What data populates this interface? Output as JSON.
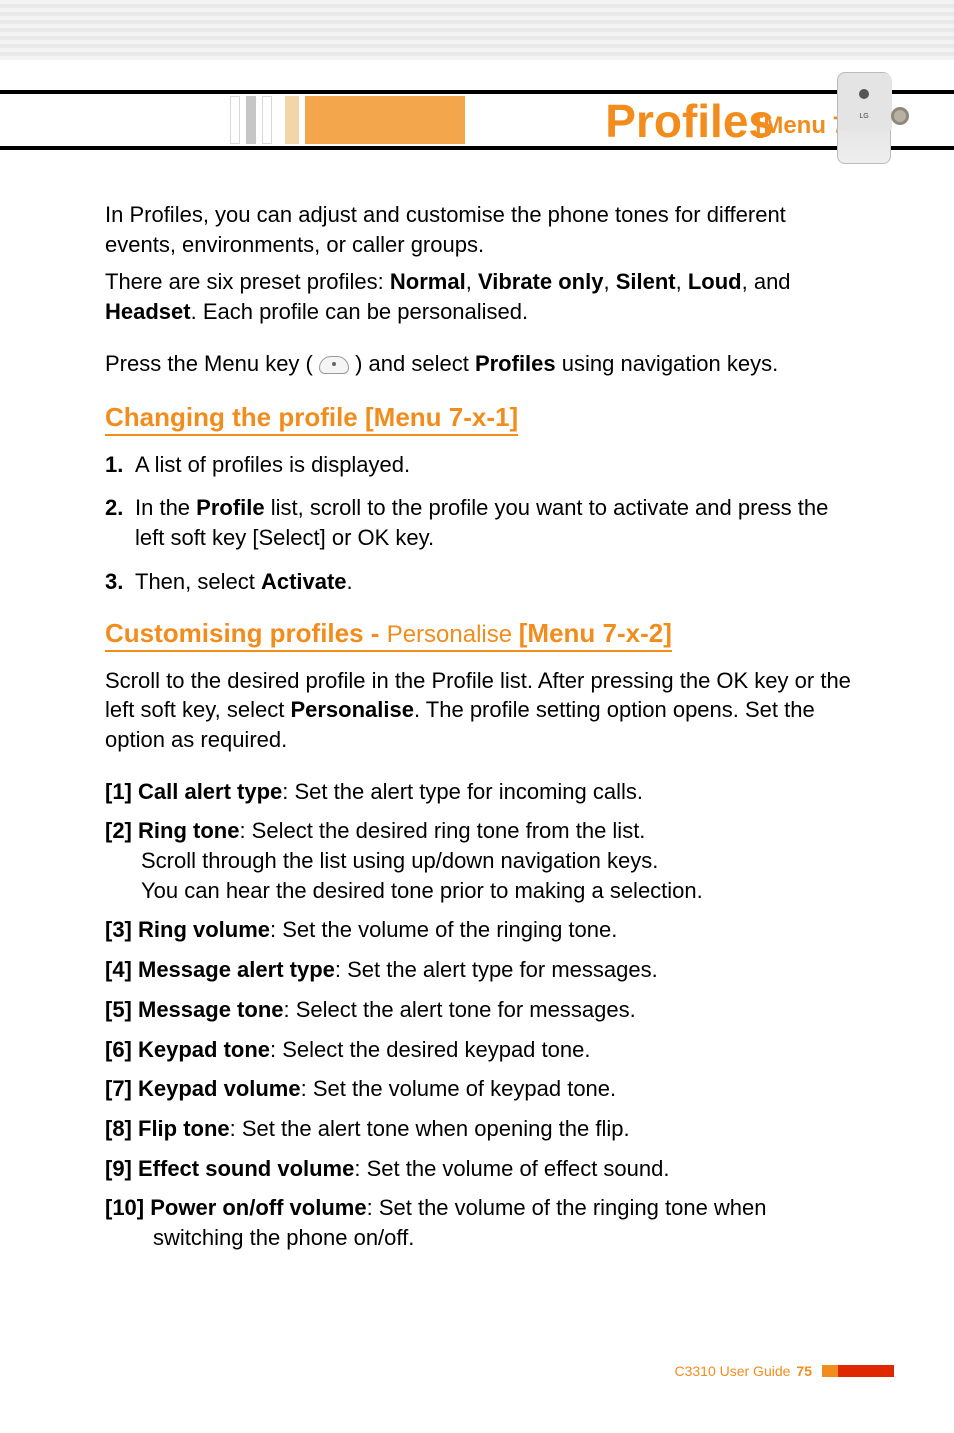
{
  "header": {
    "title": "Profiles",
    "menu_tag": "[Menu 7]"
  },
  "intro": {
    "p1": "In Profiles, you can adjust and customise the phone tones for different events, environments, or caller groups.",
    "p2_pre": "There are six preset profiles: ",
    "p2_b1": "Normal",
    "p2_s1": ", ",
    "p2_b2": "Vibrate only",
    "p2_s2": ", ",
    "p2_b3": "Silent",
    "p2_s3": ", ",
    "p2_b4": "Loud",
    "p2_s4": ", and ",
    "p2_b5": "Headset",
    "p2_post": ". Each profile can be personalised.",
    "p3_pre": "Press the Menu key ( ",
    "p3_mid": " ) and select ",
    "p3_b1": "Profiles",
    "p3_post": " using navigation keys."
  },
  "section1": {
    "title_main": "Changing the profile ",
    "title_tag": "[Menu 7-x-1]",
    "steps": [
      {
        "num": "1.",
        "text": "A list of profiles is displayed."
      },
      {
        "num": "2.",
        "pre": "In the ",
        "b": "Profile",
        "post": " list, scroll to the profile you want to activate and press the left soft key [Select] or OK key."
      },
      {
        "num": "3.",
        "pre": "Then, select ",
        "b": "Activate",
        "post": "."
      }
    ]
  },
  "section2": {
    "title_main": "Customising profiles - ",
    "title_thin": "Personalise ",
    "title_tag": "[Menu 7-x-2]",
    "intro_pre": "Scroll to the desired profile in the Profile list. After pressing the OK key or the left soft key, select ",
    "intro_b": "Personalise",
    "intro_post": ". The profile setting option opens. Set the option as required.",
    "options": [
      {
        "label": "[1] Call alert type",
        "text": ": Set the alert type for incoming calls."
      },
      {
        "label": "[2] Ring tone",
        "text": ": Select the desired ring tone from the list.",
        "cont1": "Scroll through the list using up/down navigation keys.",
        "cont2": "You can hear the desired tone prior to making a selection."
      },
      {
        "label": "[3] Ring volume",
        "text": ": Set the volume of the ringing tone."
      },
      {
        "label": "[4] Message alert type",
        "text": ": Set the alert type for messages."
      },
      {
        "label": "[5] Message tone",
        "text": ": Select the alert tone for messages."
      },
      {
        "label": "[6] Keypad tone",
        "text": ": Select the desired keypad tone."
      },
      {
        "label": "[7] Keypad volume",
        "text": ": Set the volume of keypad tone."
      },
      {
        "label": "[8] Flip tone",
        "text": ": Set the alert tone when opening the flip."
      },
      {
        "label": "[9] Effect sound volume",
        "text": ": Set the volume of effect sound."
      },
      {
        "label": "[10] Power on/off volume",
        "text": ": Set the volume of the ringing tone when switching the phone on/off.",
        "indent_needed": true
      }
    ]
  },
  "footer": {
    "product": "C3310 User Guide",
    "page": "75"
  }
}
